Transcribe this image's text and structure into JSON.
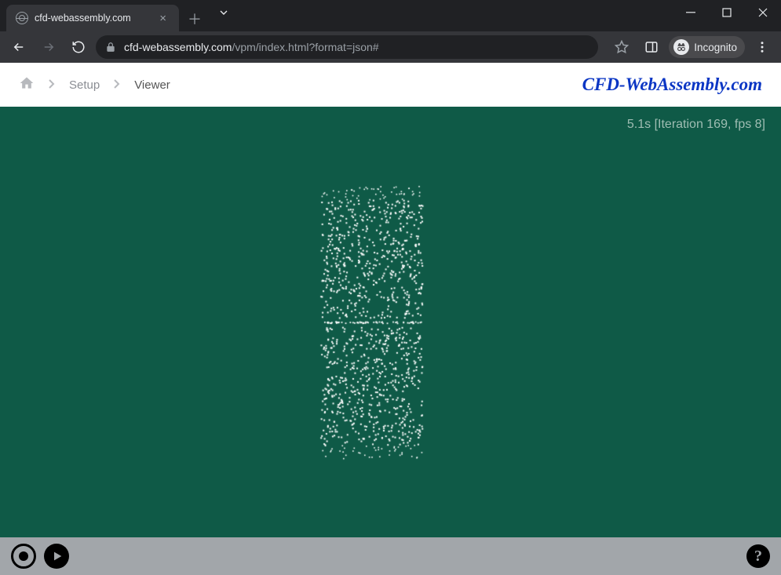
{
  "browser": {
    "tab_title": "cfd-webassembly.com",
    "url_domain": "cfd-webassembly.com",
    "url_path": "/vpm/index.html?format=json#",
    "incognito_label": "Incognito"
  },
  "page": {
    "breadcrumb": {
      "setup": "Setup",
      "viewer": "Viewer"
    },
    "brand_main": "CFD-WebAssembly",
    "brand_suffix": ".com",
    "status": {
      "time_s": 5.1,
      "iteration": 169,
      "fps": 8,
      "text": "5.1s [Iteration 169, fps 8]"
    },
    "controls": {
      "record": "record",
      "play": "play",
      "help": "?"
    },
    "viewer_bg": "#0f5a47",
    "particle_color": "#ffffff"
  }
}
